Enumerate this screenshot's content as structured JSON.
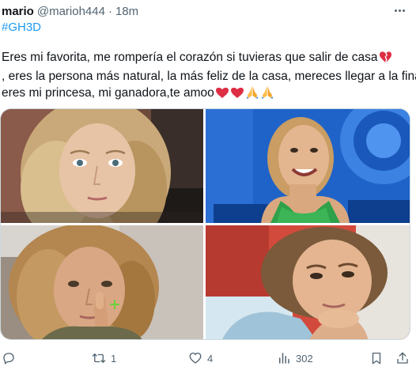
{
  "tweet": {
    "author_name": "mario",
    "author_handle": "@marioh444",
    "separator": "·",
    "time": "18m",
    "hashtag": "#GH3D",
    "text_lines": [
      "Eres mi favorita, me rompería el corazón si tuvieras que salir de casa",
      ", eres la persona más natural, la más feliz de la casa, mereces llegar a la final,",
      "eres mi princesa, mi ganadora,te amoo"
    ],
    "emojis": [
      "broken-heart-emoji",
      "red-heart-emoji",
      "red-heart-emoji",
      "folded-hands-emoji",
      "folded-hands-emoji"
    ],
    "media": [
      {
        "name": "photo-blonde-woman-closeup"
      },
      {
        "name": "photo-woman-smiling-green-top"
      },
      {
        "name": "photo-woman-touching-eye"
      },
      {
        "name": "photo-woman-resting-chin"
      }
    ]
  },
  "actions": {
    "reply_count": "",
    "retweet_count": "1",
    "like_count": "4",
    "views_count": "302"
  },
  "colors": {
    "accent": "#1d9bf0",
    "text": "#0f1419",
    "muted": "#536471",
    "heart": "#e0245e"
  },
  "icons": [
    "more-icon",
    "reply-icon",
    "retweet-icon",
    "like-icon",
    "views-icon",
    "bookmark-icon",
    "share-icon"
  ]
}
